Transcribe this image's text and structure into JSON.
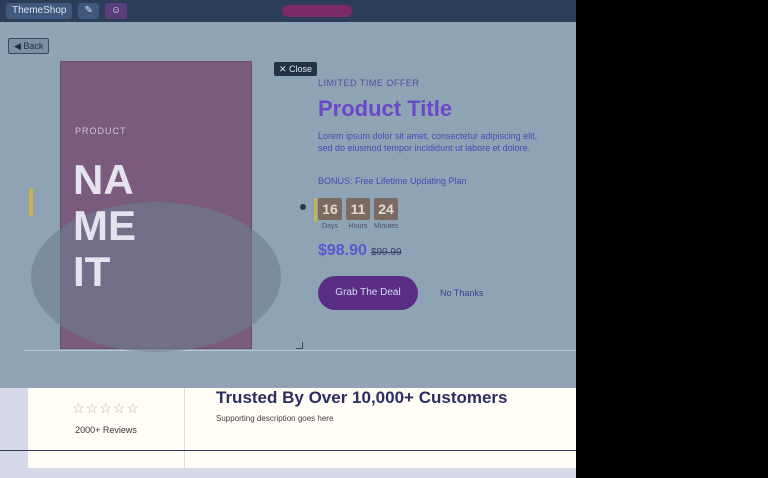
{
  "topbar": {
    "tab1": "ThemeShop",
    "tab2": "✎",
    "tab3": "☺"
  },
  "modal": {
    "back_label": "◀ Back",
    "close_label": "✕ Close",
    "image": {
      "small_text": "PRODUCT",
      "big_line1": "NA",
      "big_line2": "ME",
      "big_line3": "IT"
    },
    "eyebrow": "LIMITED TIME OFFER",
    "title": "Product Title",
    "description": "Lorem ipsum dolor sit amet, consectetur adipiscing elit, sed do eiusmod tempor incididunt ut labore et dolore.",
    "bonus_text": "BONUS: Free Lifetime Updating Plan",
    "countdown": {
      "days": "16",
      "days_label": "Days",
      "hours": "11",
      "hours_label": "Hours",
      "minutes": "24",
      "minutes_label": "Minutes"
    },
    "price": "$98.90",
    "old_price": "$99.99",
    "grab_button": "Grab The Deal",
    "no_thanks": "No Thanks"
  },
  "bottom": {
    "stars": "☆☆☆☆☆",
    "reviews": "2000+ Reviews",
    "headline": "Trusted By Over 10,000+ Customers",
    "subtext": "Supporting description goes here"
  }
}
